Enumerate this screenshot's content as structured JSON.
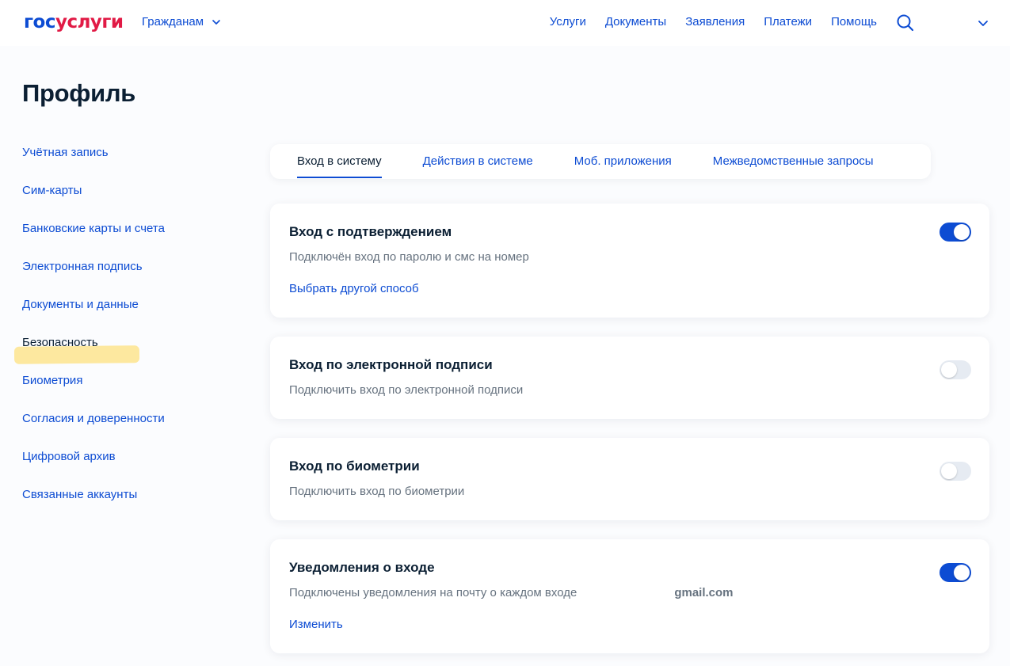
{
  "header": {
    "logo_part1": "гос",
    "logo_part2": "услуги",
    "audience_label": "Гражданам",
    "nav": [
      "Услуги",
      "Документы",
      "Заявления",
      "Платежи",
      "Помощь"
    ],
    "icons": [
      "search-icon",
      "chevron-down-icon"
    ]
  },
  "page": {
    "title": "Профиль"
  },
  "sidebar": {
    "items": [
      {
        "label": "Учётная запись",
        "active": false
      },
      {
        "label": "Сим-карты",
        "active": false
      },
      {
        "label": "Банковские карты и счета",
        "active": false
      },
      {
        "label": "Электронная подпись",
        "active": false
      },
      {
        "label": "Документы и данные",
        "active": false
      },
      {
        "label": "Безопасность",
        "active": true
      },
      {
        "label": "Биометрия",
        "active": false
      },
      {
        "label": "Согласия и доверенности",
        "active": false
      },
      {
        "label": "Цифровой архив",
        "active": false
      },
      {
        "label": "Связанные аккаунты",
        "active": false
      }
    ]
  },
  "tabs": [
    {
      "label": "Вход в систему",
      "active": true
    },
    {
      "label": "Действия в системе",
      "active": false
    },
    {
      "label": "Моб. приложения",
      "active": false
    },
    {
      "label": "Межведомственные запросы",
      "active": false
    }
  ],
  "cards": [
    {
      "title": "Вход с подтверждением",
      "description": "Подключён вход по паролю и смс на номер",
      "link": "Выбрать другой способ",
      "toggle_on": true
    },
    {
      "title": "Вход по электронной подписи",
      "description": "Подключить вход по электронной подписи",
      "toggle_on": false
    },
    {
      "title": "Вход по биометрии",
      "description": "Подключить вход по биометрии",
      "toggle_on": false
    },
    {
      "title": "Уведомления о входе",
      "description": "Подключены уведомления на почту о каждом входе",
      "email_tail": "gmail.com",
      "link": "Изменить",
      "toggle_on": true
    }
  ],
  "colors": {
    "accent": "#0d4cd3",
    "logo_red": "#e11a45",
    "text": "#0b1f33",
    "muted": "#66727f"
  }
}
